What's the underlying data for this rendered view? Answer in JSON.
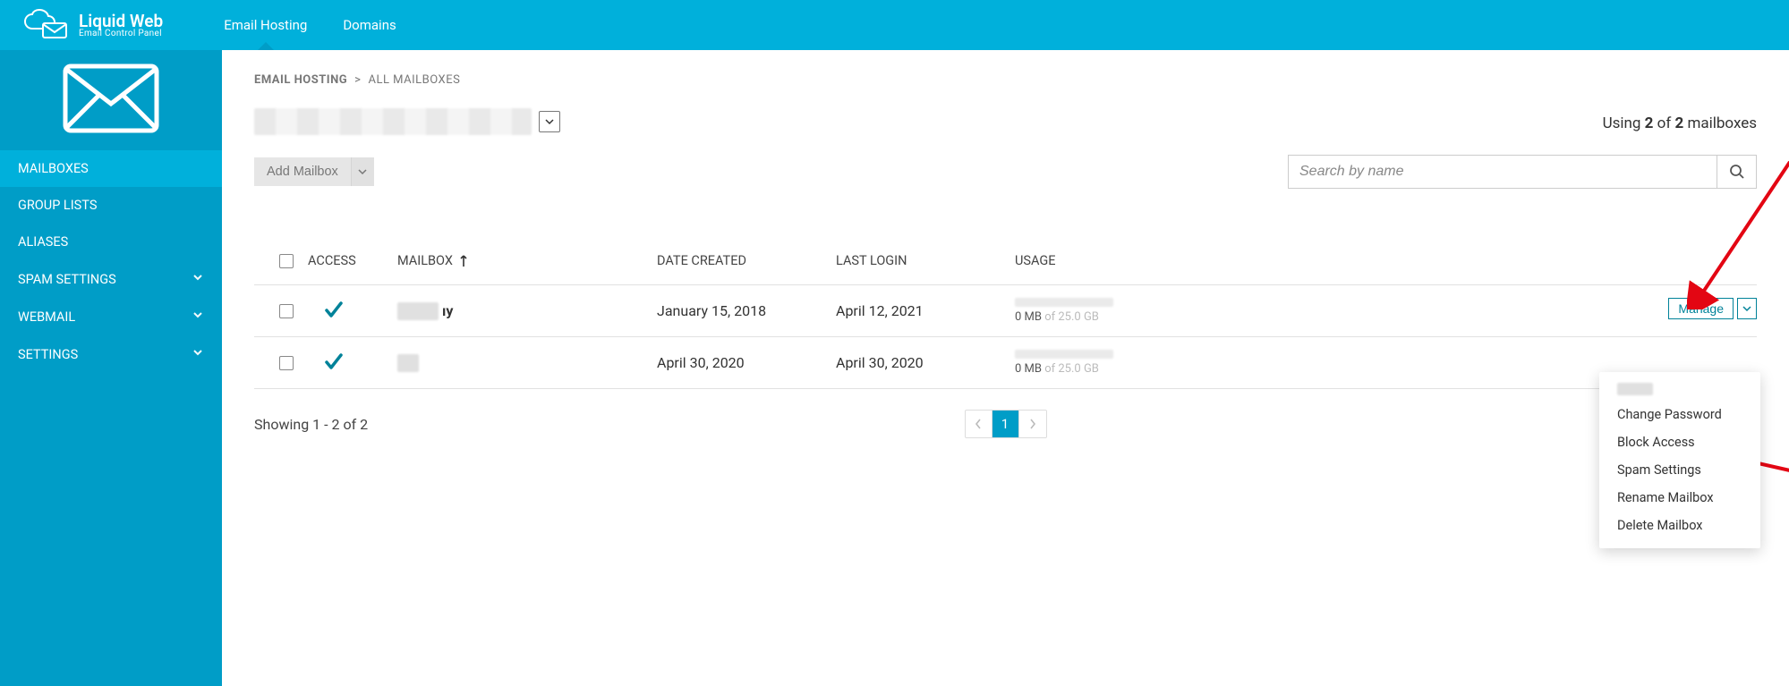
{
  "brand": {
    "name": "Liquid Web",
    "subtitle": "Email Control Panel"
  },
  "topnav": {
    "email_hosting": "Email Hosting",
    "domains": "Domains"
  },
  "sidebar": {
    "items": [
      {
        "label": "MAILBOXES",
        "has_submenu": false,
        "active": true
      },
      {
        "label": "GROUP LISTS",
        "has_submenu": false,
        "active": false
      },
      {
        "label": "ALIASES",
        "has_submenu": false,
        "active": false
      },
      {
        "label": "SPAM SETTINGS",
        "has_submenu": true,
        "active": false
      },
      {
        "label": "WEBMAIL",
        "has_submenu": true,
        "active": false
      },
      {
        "label": "SETTINGS",
        "has_submenu": true,
        "active": false
      }
    ]
  },
  "breadcrumb": {
    "root": "EMAIL HOSTING",
    "sep": ">",
    "leaf": "ALL MAILBOXES"
  },
  "usage_summary": {
    "prefix": "Using ",
    "used": "2",
    "mid": " of ",
    "total": "2",
    "suffix": " mailboxes"
  },
  "toolbar": {
    "add_label": "Add Mailbox"
  },
  "search": {
    "placeholder": "Search by name",
    "value": ""
  },
  "table": {
    "headers": {
      "access": "ACCESS",
      "mailbox": "MAILBOX",
      "date_created": "DATE CREATED",
      "last_login": "LAST LOGIN",
      "usage": "USAGE"
    },
    "sort_icon_on": "mailbox",
    "rows": [
      {
        "mailbox_suffix": "ıy",
        "date_created": "January 15, 2018",
        "last_login": "April 12, 2021",
        "usage_used": "0 MB",
        "usage_of": " of 25.0 GB",
        "has_manage": true
      },
      {
        "mailbox_suffix": "",
        "date_created": "April 30, 2020",
        "last_login": "April 30, 2020",
        "usage_used": "0 MB",
        "usage_of": " of 25.0 GB",
        "has_manage": false
      }
    ],
    "manage_label": "Manage"
  },
  "footer": {
    "showing": "Showing 1 - 2 of 2",
    "page": "1"
  },
  "dropdown": {
    "items": [
      "Change Password",
      "Block Access",
      "Spam Settings",
      "Rename Mailbox",
      "Delete Mailbox"
    ]
  }
}
